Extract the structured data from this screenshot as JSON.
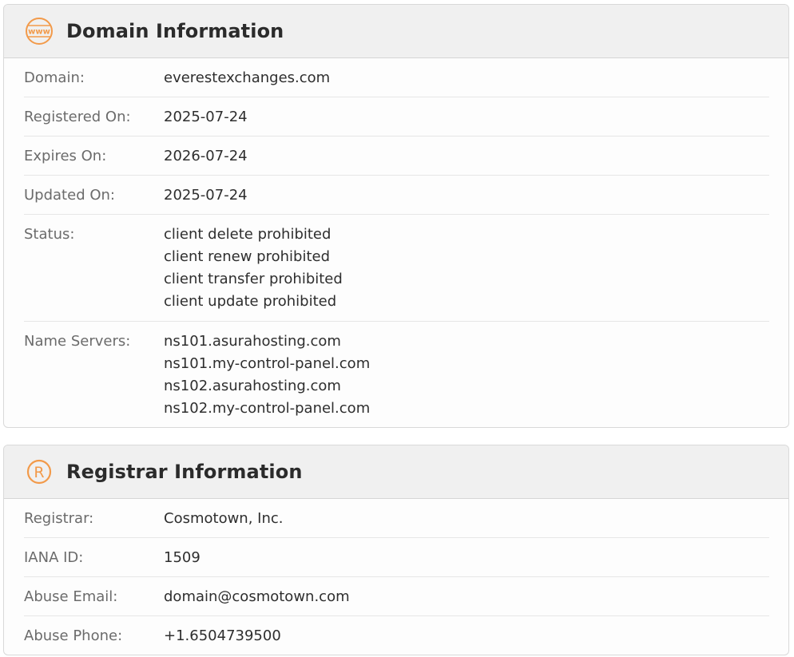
{
  "domain_info": {
    "icon": "www-icon",
    "icon_text": "www",
    "title": "Domain Information",
    "domain": {
      "label": "Domain:",
      "value": "everestexchanges.com"
    },
    "registered": {
      "label": "Registered On:",
      "value": "2025-07-24"
    },
    "expires": {
      "label": "Expires On:",
      "value": "2026-07-24"
    },
    "updated": {
      "label": "Updated On:",
      "value": "2025-07-24"
    },
    "status": {
      "label": "Status:",
      "values": [
        "client delete prohibited",
        "client renew prohibited",
        "client transfer prohibited",
        "client update prohibited"
      ]
    },
    "name_servers": {
      "label": "Name Servers:",
      "values": [
        "ns101.asurahosting.com",
        "ns101.my-control-panel.com",
        "ns102.asurahosting.com",
        "ns102.my-control-panel.com"
      ]
    }
  },
  "registrar_info": {
    "icon": "registered-trademark-icon",
    "icon_text": "R",
    "title": "Registrar Information",
    "registrar": {
      "label": "Registrar:",
      "value": "Cosmotown, Inc."
    },
    "iana": {
      "label": "IANA ID:",
      "value": "1509"
    },
    "abuse_email": {
      "label": "Abuse Email:",
      "value": "domain@cosmotown.com"
    },
    "abuse_phone": {
      "label": "Abuse Phone:",
      "value": "+1.6504739500"
    }
  },
  "colors": {
    "accent": "#f29a4a",
    "header_bg": "#f0f0f0"
  }
}
